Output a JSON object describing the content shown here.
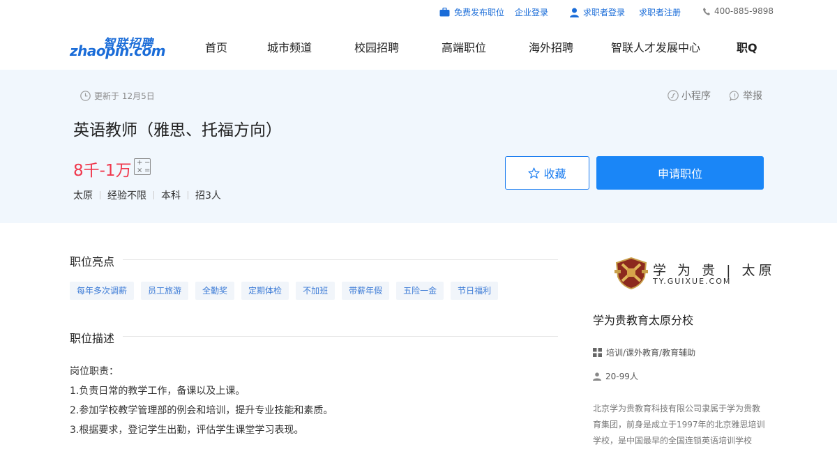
{
  "topbar": {
    "post_job": "免费发布职位",
    "employer_login": "企业登录",
    "seeker_login": "求职者登录",
    "seeker_register": "求职者注册",
    "phone": "400-885-9898"
  },
  "logo": {
    "cn": "智联招聘",
    "en": "zhaopin.com"
  },
  "nav": [
    "首页",
    "城市频道",
    "校园招聘",
    "高端职位",
    "海外招聘",
    "智联人才发展中心",
    "职Q"
  ],
  "job": {
    "updated": "更新于 12月5日",
    "mini_program": "小程序",
    "report": "举报",
    "title": "英语教师（雅思、托福方向）",
    "salary": "8千-1万",
    "requirements": [
      "太原",
      "经验不限",
      "本科",
      "招3人"
    ],
    "favorite_label": "收藏",
    "apply_label": "申请职位"
  },
  "highlights": {
    "heading": "职位亮点",
    "tags": [
      "每年多次调薪",
      "员工旅游",
      "全勤奖",
      "定期体检",
      "不加班",
      "带薪年假",
      "五险一金",
      "节日福利"
    ]
  },
  "description": {
    "heading": "职位描述",
    "lines": [
      "岗位职责：",
      "1.负责日常的教学工作，备课以及上课。",
      "2.参加学校教学管理部的例会和培训，提升专业技能和素质。",
      "3.根据要求，登记学生出勤，评估学生课堂学习表现。"
    ]
  },
  "company": {
    "logo_cn": "学 为 贵 | 太原",
    "logo_en": "TY.GUIXUE.COM",
    "name": "学为贵教育太原分校",
    "industry": "培训/课外教育/教育辅助",
    "size": "20-99人",
    "intro": "北京学为贵教育科技有限公司隶属于学为贵教育集团，前身是成立于1997年的北京雅思培训学校，是中国最早的全国连锁英语培训学校"
  },
  "colors": {
    "brand_blue": "#1a86f7",
    "salary_red": "#f0374c",
    "banner_bg": "#f1f7fd"
  }
}
